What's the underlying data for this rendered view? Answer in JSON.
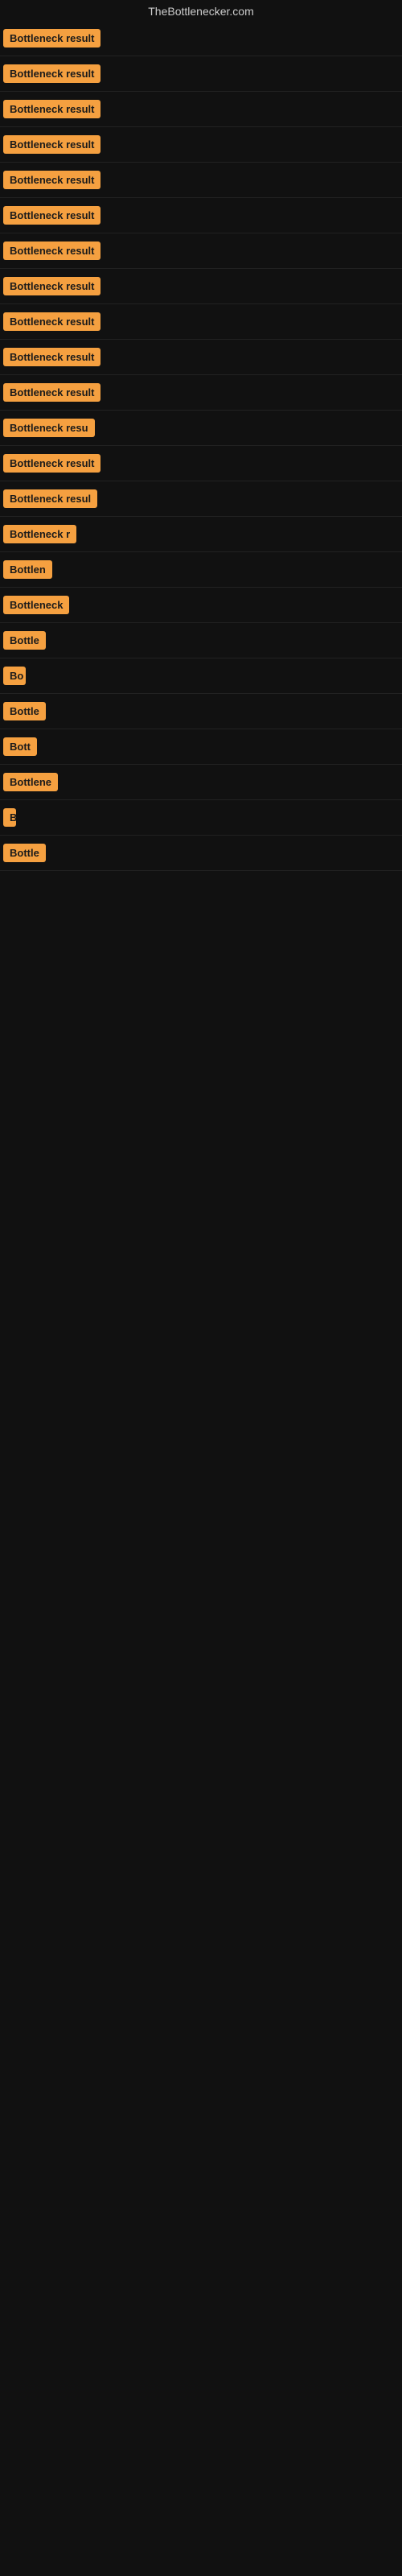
{
  "site": {
    "title": "TheBottlenecker.com"
  },
  "rows": [
    {
      "id": 1,
      "badge_text": "Bottleneck result",
      "visible_width": "full"
    },
    {
      "id": 2,
      "badge_text": "Bottleneck result",
      "visible_width": "full"
    },
    {
      "id": 3,
      "badge_text": "Bottleneck result",
      "visible_width": "full"
    },
    {
      "id": 4,
      "badge_text": "Bottleneck result",
      "visible_width": "full"
    },
    {
      "id": 5,
      "badge_text": "Bottleneck result",
      "visible_width": "full"
    },
    {
      "id": 6,
      "badge_text": "Bottleneck result",
      "visible_width": "full"
    },
    {
      "id": 7,
      "badge_text": "Bottleneck result",
      "visible_width": "full"
    },
    {
      "id": 8,
      "badge_text": "Bottleneck result",
      "visible_width": "full"
    },
    {
      "id": 9,
      "badge_text": "Bottleneck result",
      "visible_width": "full"
    },
    {
      "id": 10,
      "badge_text": "Bottleneck result",
      "visible_width": "full"
    },
    {
      "id": 11,
      "badge_text": "Bottleneck result",
      "visible_width": "full"
    },
    {
      "id": 12,
      "badge_text": "Bottleneck resu",
      "visible_width": "partial"
    },
    {
      "id": 13,
      "badge_text": "Bottleneck result",
      "visible_width": "full"
    },
    {
      "id": 14,
      "badge_text": "Bottleneck resul",
      "visible_width": "partial"
    },
    {
      "id": 15,
      "badge_text": "Bottleneck r",
      "visible_width": "small"
    },
    {
      "id": 16,
      "badge_text": "Bottlen",
      "visible_width": "tiny"
    },
    {
      "id": 17,
      "badge_text": "Bottleneck",
      "visible_width": "small"
    },
    {
      "id": 18,
      "badge_text": "Bottle",
      "visible_width": "tiny"
    },
    {
      "id": 19,
      "badge_text": "Bo",
      "visible_width": "micro"
    },
    {
      "id": 20,
      "badge_text": "Bottle",
      "visible_width": "tiny"
    },
    {
      "id": 21,
      "badge_text": "Bott",
      "visible_width": "micro"
    },
    {
      "id": 22,
      "badge_text": "Bottlene",
      "visible_width": "small"
    },
    {
      "id": 23,
      "badge_text": "B",
      "visible_width": "micro"
    },
    {
      "id": 24,
      "badge_text": "Bottle",
      "visible_width": "tiny"
    }
  ],
  "colors": {
    "badge_bg": "#f5a040",
    "badge_text": "#1a1a1a",
    "site_title": "#cccccc",
    "background": "#111111",
    "row_border": "#222222"
  }
}
